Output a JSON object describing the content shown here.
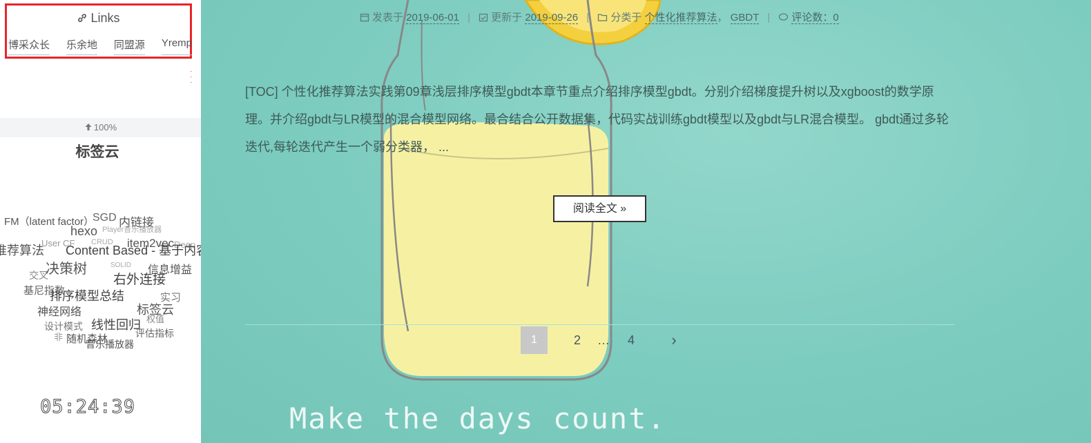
{
  "sidebar": {
    "links": {
      "title": "Links",
      "items": [
        "博采众长",
        "乐余地",
        "同盟源",
        "Yremp"
      ]
    },
    "progress_text": "100%",
    "tagcloud_title": "标签云",
    "tags": [
      "FM（latent factor）",
      "SGD",
      "内链接",
      "hexo",
      "Player音乐播放器",
      "User CF",
      "CRUD",
      "item2vec",
      "Deep",
      "推荐算法",
      "Content Based - 基于内容",
      "决策树",
      "信息增益",
      "右外连接",
      "交叉",
      "SOLID",
      "基尼指数",
      "排序模型总结",
      "实习",
      "神经网络",
      "标签云",
      "设计模式",
      "线性回归",
      "权值",
      "非",
      "随机森林",
      "评估指标",
      "音乐播放器"
    ],
    "clock": "05:24:39"
  },
  "post": {
    "meta": {
      "published_label": "发表于",
      "published_date": "2019-06-01",
      "updated_label": "更新于",
      "updated_date": "2019-09-26",
      "category_label": "分类于",
      "categories": [
        "个性化推荐算法",
        "GBDT"
      ],
      "comments_label": "评论数：",
      "comments_count": "0"
    },
    "excerpt": "[TOC] 个性化推荐算法实践第09章浅层排序模型gbdt本章节重点介绍排序模型gbdt。分别介绍梯度提升树以及xgboost的数学原理。并介绍gbdt与LR模型的混合模型网络。最合结合公开数据集，代码实战训练gbdt模型以及gbdt与LR混合模型。 gbdt通过多轮迭代,每轮迭代产生一个弱分类器， ...",
    "read_more": "阅读全文 »"
  },
  "pagination": {
    "current": "1",
    "pages": [
      "2",
      "…",
      "4"
    ],
    "next": "›"
  },
  "background_motto": "Make the days count.",
  "colors": {
    "accent_red": "#e8242b",
    "background_teal": "#7fcdc0",
    "jar_lemonade": "#f6f1a2"
  }
}
